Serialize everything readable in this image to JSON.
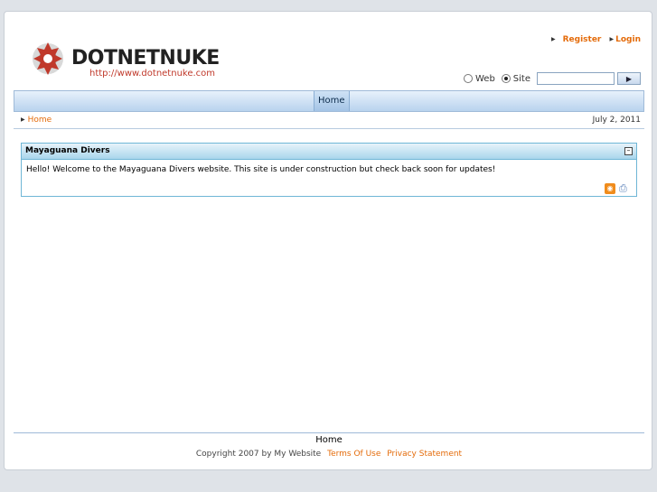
{
  "header": {
    "logo_text": "DOTNETNUKE",
    "logo_url": "http://www.dotnetnuke.com",
    "register_label": "Register",
    "login_label": "Login"
  },
  "search": {
    "web_label": "Web",
    "site_label": "Site",
    "selected": "Site",
    "query": "",
    "go_icon": "play-icon"
  },
  "nav": {
    "items": [
      {
        "label": "Home",
        "active": true
      }
    ]
  },
  "breadcrumb": {
    "label": "Home"
  },
  "date": "July 2, 2011",
  "module": {
    "title": "Mayaguana Divers",
    "body": "Hello! Welcome to the Mayaguana Divers website. This site is under construction but check back soon for updates!"
  },
  "footer": {
    "nav_home": "Home",
    "copyright": "Copyright 2007 by My Website",
    "terms_label": "Terms Of Use",
    "privacy_label": "Privacy Statement"
  },
  "colors": {
    "accent": "#e46b0a",
    "nav_blue": "#b9d3ee",
    "module_border": "#6fb6d6"
  }
}
